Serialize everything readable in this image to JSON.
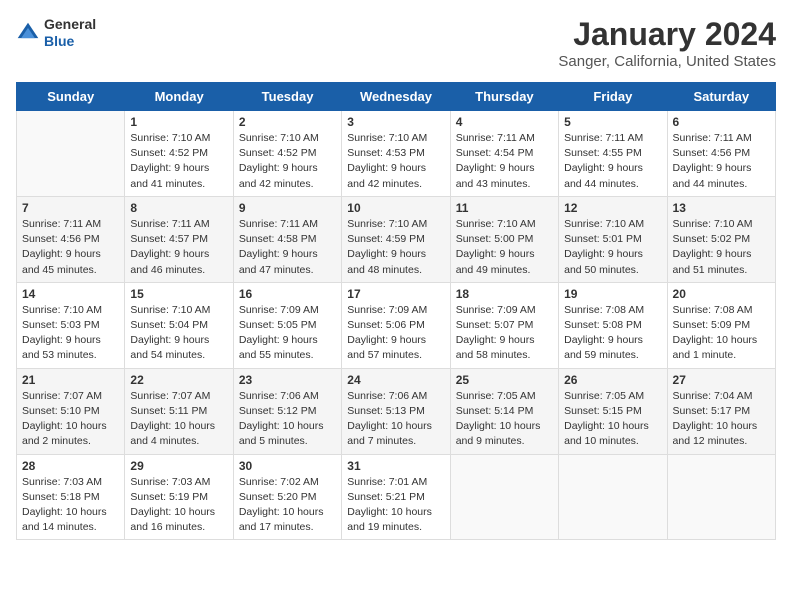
{
  "header": {
    "logo_line1": "General",
    "logo_line2": "Blue",
    "title": "January 2024",
    "subtitle": "Sanger, California, United States"
  },
  "days_of_week": [
    "Sunday",
    "Monday",
    "Tuesday",
    "Wednesday",
    "Thursday",
    "Friday",
    "Saturday"
  ],
  "weeks": [
    [
      {
        "day": "",
        "data": []
      },
      {
        "day": "1",
        "sunrise": "Sunrise: 7:10 AM",
        "sunset": "Sunset: 4:52 PM",
        "daylight": "Daylight: 9 hours and 41 minutes."
      },
      {
        "day": "2",
        "sunrise": "Sunrise: 7:10 AM",
        "sunset": "Sunset: 4:52 PM",
        "daylight": "Daylight: 9 hours and 42 minutes."
      },
      {
        "day": "3",
        "sunrise": "Sunrise: 7:10 AM",
        "sunset": "Sunset: 4:53 PM",
        "daylight": "Daylight: 9 hours and 42 minutes."
      },
      {
        "day": "4",
        "sunrise": "Sunrise: 7:11 AM",
        "sunset": "Sunset: 4:54 PM",
        "daylight": "Daylight: 9 hours and 43 minutes."
      },
      {
        "day": "5",
        "sunrise": "Sunrise: 7:11 AM",
        "sunset": "Sunset: 4:55 PM",
        "daylight": "Daylight: 9 hours and 44 minutes."
      },
      {
        "day": "6",
        "sunrise": "Sunrise: 7:11 AM",
        "sunset": "Sunset: 4:56 PM",
        "daylight": "Daylight: 9 hours and 44 minutes."
      }
    ],
    [
      {
        "day": "7",
        "sunrise": "Sunrise: 7:11 AM",
        "sunset": "Sunset: 4:56 PM",
        "daylight": "Daylight: 9 hours and 45 minutes."
      },
      {
        "day": "8",
        "sunrise": "Sunrise: 7:11 AM",
        "sunset": "Sunset: 4:57 PM",
        "daylight": "Daylight: 9 hours and 46 minutes."
      },
      {
        "day": "9",
        "sunrise": "Sunrise: 7:11 AM",
        "sunset": "Sunset: 4:58 PM",
        "daylight": "Daylight: 9 hours and 47 minutes."
      },
      {
        "day": "10",
        "sunrise": "Sunrise: 7:10 AM",
        "sunset": "Sunset: 4:59 PM",
        "daylight": "Daylight: 9 hours and 48 minutes."
      },
      {
        "day": "11",
        "sunrise": "Sunrise: 7:10 AM",
        "sunset": "Sunset: 5:00 PM",
        "daylight": "Daylight: 9 hours and 49 minutes."
      },
      {
        "day": "12",
        "sunrise": "Sunrise: 7:10 AM",
        "sunset": "Sunset: 5:01 PM",
        "daylight": "Daylight: 9 hours and 50 minutes."
      },
      {
        "day": "13",
        "sunrise": "Sunrise: 7:10 AM",
        "sunset": "Sunset: 5:02 PM",
        "daylight": "Daylight: 9 hours and 51 minutes."
      }
    ],
    [
      {
        "day": "14",
        "sunrise": "Sunrise: 7:10 AM",
        "sunset": "Sunset: 5:03 PM",
        "daylight": "Daylight: 9 hours and 53 minutes."
      },
      {
        "day": "15",
        "sunrise": "Sunrise: 7:10 AM",
        "sunset": "Sunset: 5:04 PM",
        "daylight": "Daylight: 9 hours and 54 minutes."
      },
      {
        "day": "16",
        "sunrise": "Sunrise: 7:09 AM",
        "sunset": "Sunset: 5:05 PM",
        "daylight": "Daylight: 9 hours and 55 minutes."
      },
      {
        "day": "17",
        "sunrise": "Sunrise: 7:09 AM",
        "sunset": "Sunset: 5:06 PM",
        "daylight": "Daylight: 9 hours and 57 minutes."
      },
      {
        "day": "18",
        "sunrise": "Sunrise: 7:09 AM",
        "sunset": "Sunset: 5:07 PM",
        "daylight": "Daylight: 9 hours and 58 minutes."
      },
      {
        "day": "19",
        "sunrise": "Sunrise: 7:08 AM",
        "sunset": "Sunset: 5:08 PM",
        "daylight": "Daylight: 9 hours and 59 minutes."
      },
      {
        "day": "20",
        "sunrise": "Sunrise: 7:08 AM",
        "sunset": "Sunset: 5:09 PM",
        "daylight": "Daylight: 10 hours and 1 minute."
      }
    ],
    [
      {
        "day": "21",
        "sunrise": "Sunrise: 7:07 AM",
        "sunset": "Sunset: 5:10 PM",
        "daylight": "Daylight: 10 hours and 2 minutes."
      },
      {
        "day": "22",
        "sunrise": "Sunrise: 7:07 AM",
        "sunset": "Sunset: 5:11 PM",
        "daylight": "Daylight: 10 hours and 4 minutes."
      },
      {
        "day": "23",
        "sunrise": "Sunrise: 7:06 AM",
        "sunset": "Sunset: 5:12 PM",
        "daylight": "Daylight: 10 hours and 5 minutes."
      },
      {
        "day": "24",
        "sunrise": "Sunrise: 7:06 AM",
        "sunset": "Sunset: 5:13 PM",
        "daylight": "Daylight: 10 hours and 7 minutes."
      },
      {
        "day": "25",
        "sunrise": "Sunrise: 7:05 AM",
        "sunset": "Sunset: 5:14 PM",
        "daylight": "Daylight: 10 hours and 9 minutes."
      },
      {
        "day": "26",
        "sunrise": "Sunrise: 7:05 AM",
        "sunset": "Sunset: 5:15 PM",
        "daylight": "Daylight: 10 hours and 10 minutes."
      },
      {
        "day": "27",
        "sunrise": "Sunrise: 7:04 AM",
        "sunset": "Sunset: 5:17 PM",
        "daylight": "Daylight: 10 hours and 12 minutes."
      }
    ],
    [
      {
        "day": "28",
        "sunrise": "Sunrise: 7:03 AM",
        "sunset": "Sunset: 5:18 PM",
        "daylight": "Daylight: 10 hours and 14 minutes."
      },
      {
        "day": "29",
        "sunrise": "Sunrise: 7:03 AM",
        "sunset": "Sunset: 5:19 PM",
        "daylight": "Daylight: 10 hours and 16 minutes."
      },
      {
        "day": "30",
        "sunrise": "Sunrise: 7:02 AM",
        "sunset": "Sunset: 5:20 PM",
        "daylight": "Daylight: 10 hours and 17 minutes."
      },
      {
        "day": "31",
        "sunrise": "Sunrise: 7:01 AM",
        "sunset": "Sunset: 5:21 PM",
        "daylight": "Daylight: 10 hours and 19 minutes."
      },
      {
        "day": "",
        "empty": true
      },
      {
        "day": "",
        "empty": true
      },
      {
        "day": "",
        "empty": true
      }
    ]
  ]
}
